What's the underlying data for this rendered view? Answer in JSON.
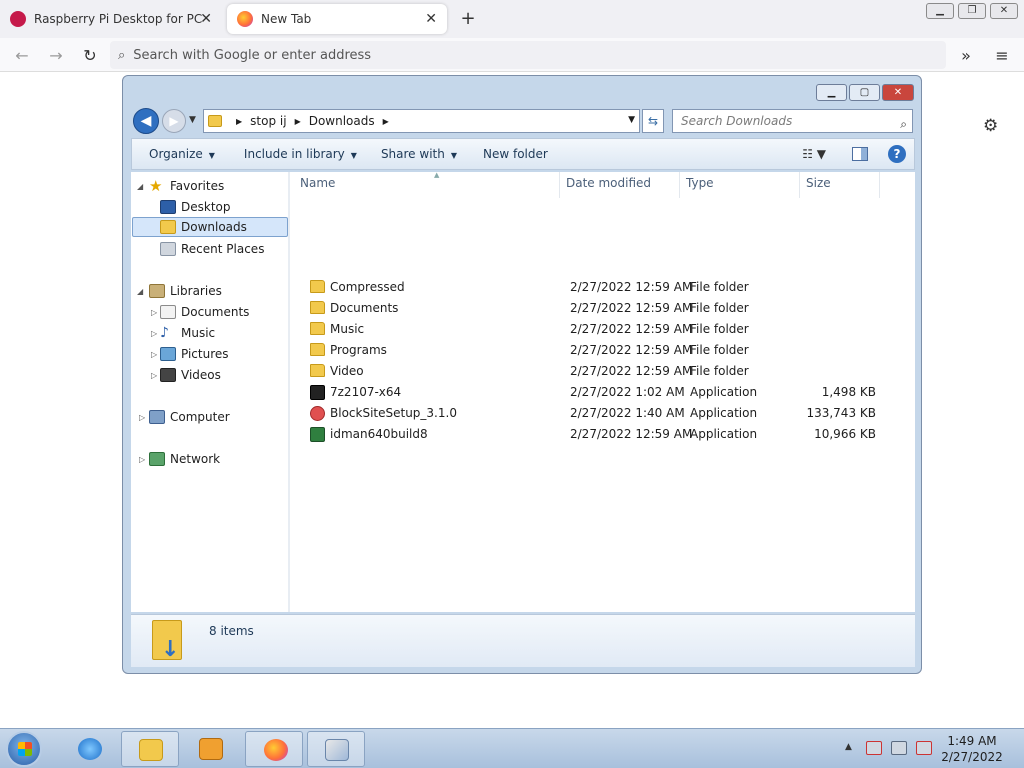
{
  "browser": {
    "tabs": [
      {
        "title": "Raspberry Pi Desktop for PC an",
        "active": false,
        "favicon": "raspberry-favicon"
      },
      {
        "title": "New Tab",
        "active": true,
        "favicon": "firefox-favicon"
      }
    ],
    "close_glyph": "✕",
    "new_tab_glyph": "+",
    "window_controls": {
      "minimize": "▁",
      "restore": "❐",
      "close": "✕"
    },
    "url_placeholder": "Search with Google or enter address",
    "nav": {
      "back": "←",
      "forward": "→",
      "reload": "↻",
      "overflow": "»",
      "menu": "≡"
    },
    "settings_glyph": "⚙"
  },
  "explorer": {
    "controls": {
      "minimize": "▁",
      "maximize": "▢",
      "close": "✕"
    },
    "breadcrumb": [
      "stop ij",
      "Downloads"
    ],
    "search_placeholder": "Search Downloads",
    "toolbar": {
      "organize": "Organize",
      "include_in_library": "Include in library",
      "share_with": "Share with",
      "new_folder": "New folder",
      "help": "?"
    },
    "nav_pane": {
      "favorites": {
        "label": "Favorites",
        "items": [
          "Desktop",
          "Downloads",
          "Recent Places"
        ]
      },
      "libraries": {
        "label": "Libraries",
        "items": [
          "Documents",
          "Music",
          "Pictures",
          "Videos"
        ]
      },
      "computer": "Computer",
      "network": "Network",
      "selected": "Downloads"
    },
    "columns": [
      "Name",
      "Date modified",
      "Type",
      "Size"
    ],
    "files": [
      {
        "name": "Compressed",
        "date": "2/27/2022 12:59 AM",
        "type": "File folder",
        "size": "",
        "icon": "folder-icon"
      },
      {
        "name": "Documents",
        "date": "2/27/2022 12:59 AM",
        "type": "File folder",
        "size": "",
        "icon": "folder-icon"
      },
      {
        "name": "Music",
        "date": "2/27/2022 12:59 AM",
        "type": "File folder",
        "size": "",
        "icon": "folder-icon"
      },
      {
        "name": "Programs",
        "date": "2/27/2022 12:59 AM",
        "type": "File folder",
        "size": "",
        "icon": "folder-icon"
      },
      {
        "name": "Video",
        "date": "2/27/2022 12:59 AM",
        "type": "File folder",
        "size": "",
        "icon": "folder-icon"
      },
      {
        "name": "7z2107-x64",
        "date": "2/27/2022 1:02 AM",
        "type": "Application",
        "size": "1,498 KB",
        "icon": "7zip-icon"
      },
      {
        "name": "BlockSiteSetup_3.1.0",
        "date": "2/27/2022 1:40 AM",
        "type": "Application",
        "size": "133,743 KB",
        "icon": "blocksite-icon"
      },
      {
        "name": "idman640build8",
        "date": "2/27/2022 12:59 AM",
        "type": "Application",
        "size": "10,966 KB",
        "icon": "idm-icon"
      }
    ],
    "status": "8 items"
  },
  "taskbar": {
    "clock_time": "1:49 AM",
    "clock_date": "2/27/2022",
    "tray_arrow": "▲"
  },
  "colors": {
    "explorer_frame": "#c5d7ea",
    "selection": "#d5e6fa",
    "taskbar": "#a8c0dc"
  }
}
